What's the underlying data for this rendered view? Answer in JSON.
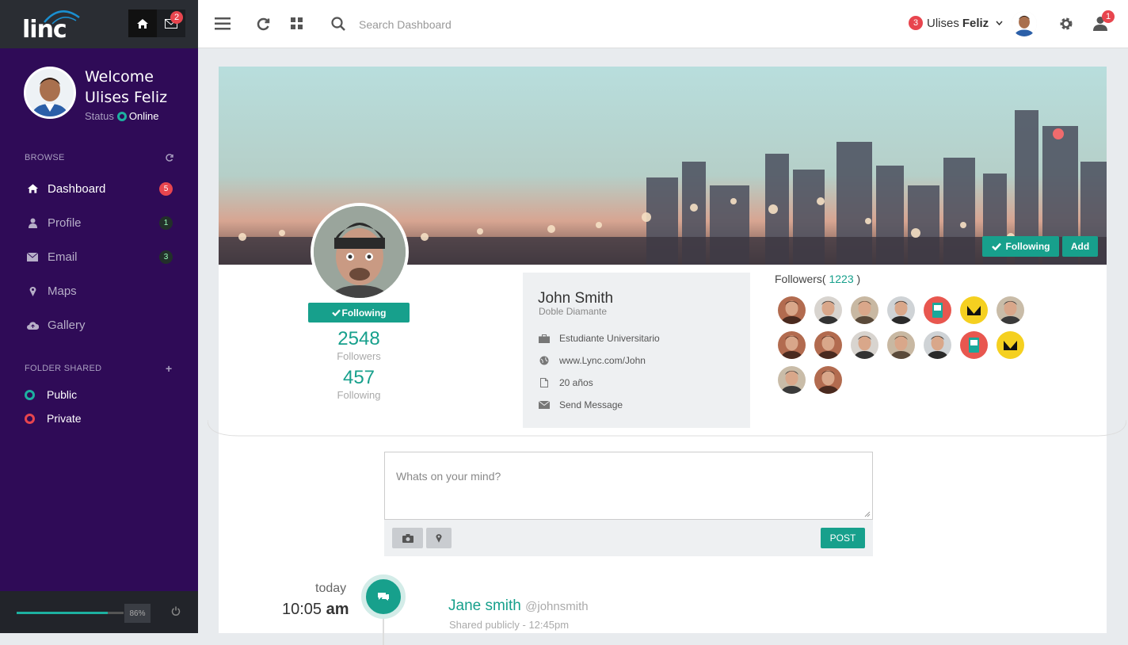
{
  "app": {
    "logo": "linc",
    "mail_badge": "2"
  },
  "sidebar": {
    "welcome_line1": "Welcome",
    "welcome_line2": "Ulises Feliz",
    "status_label": "Status",
    "status_value": "Online",
    "browse_title": "BROWSE",
    "items": [
      {
        "label": "Dashboard",
        "badge": "5",
        "icon": "home-icon",
        "active": true
      },
      {
        "label": "Profile",
        "badge": "1",
        "icon": "user-icon"
      },
      {
        "label": "Email",
        "badge": "3",
        "icon": "envelope-icon"
      },
      {
        "label": "Maps",
        "badge": "",
        "icon": "map-marker-icon"
      },
      {
        "label": "Gallery",
        "badge": "",
        "icon": "cloud-icon"
      }
    ],
    "folder_title": "FOLDER SHARED",
    "folders": [
      {
        "label": "Public",
        "color": "#1db0a0"
      },
      {
        "label": "Private",
        "color": "#e8454e"
      }
    ],
    "progress_percent": 86,
    "progress_label": "86%"
  },
  "topbar": {
    "search_placeholder": "Search Dashboard",
    "user_badge": "3",
    "user_first": "Ulises",
    "user_last": "Feliz",
    "notif_badge": "1"
  },
  "profile": {
    "cover_following": "Following",
    "cover_add": "Add",
    "follow_button": "Following",
    "followers_count": "2548",
    "followers_label": "Followers",
    "following_count": "457",
    "following_label": "Following",
    "name": "John Smith",
    "subtitle": "Doble Diamante",
    "details": [
      {
        "icon": "briefcase-icon",
        "text": "Estudiante Universitario"
      },
      {
        "icon": "globe-icon",
        "text": "www.Lync.com/John"
      },
      {
        "icon": "file-icon",
        "text": "20 años"
      },
      {
        "icon": "envelope-icon",
        "text": "Send Message"
      }
    ],
    "followers_title": "Followers(",
    "followers_total": "1223",
    "followers_close": ")"
  },
  "composer": {
    "placeholder": "Whats on your mind?",
    "post_label": "POST"
  },
  "timeline": {
    "day": "today",
    "time": "10:05",
    "ampm": "am",
    "name": "Jane smith",
    "handle": "@johnsmith",
    "meta": "Shared publicly - 12:45pm"
  },
  "colors": {
    "accent": "#17a08c",
    "sidebar": "#2f0b57",
    "badge": "#e8454e"
  }
}
